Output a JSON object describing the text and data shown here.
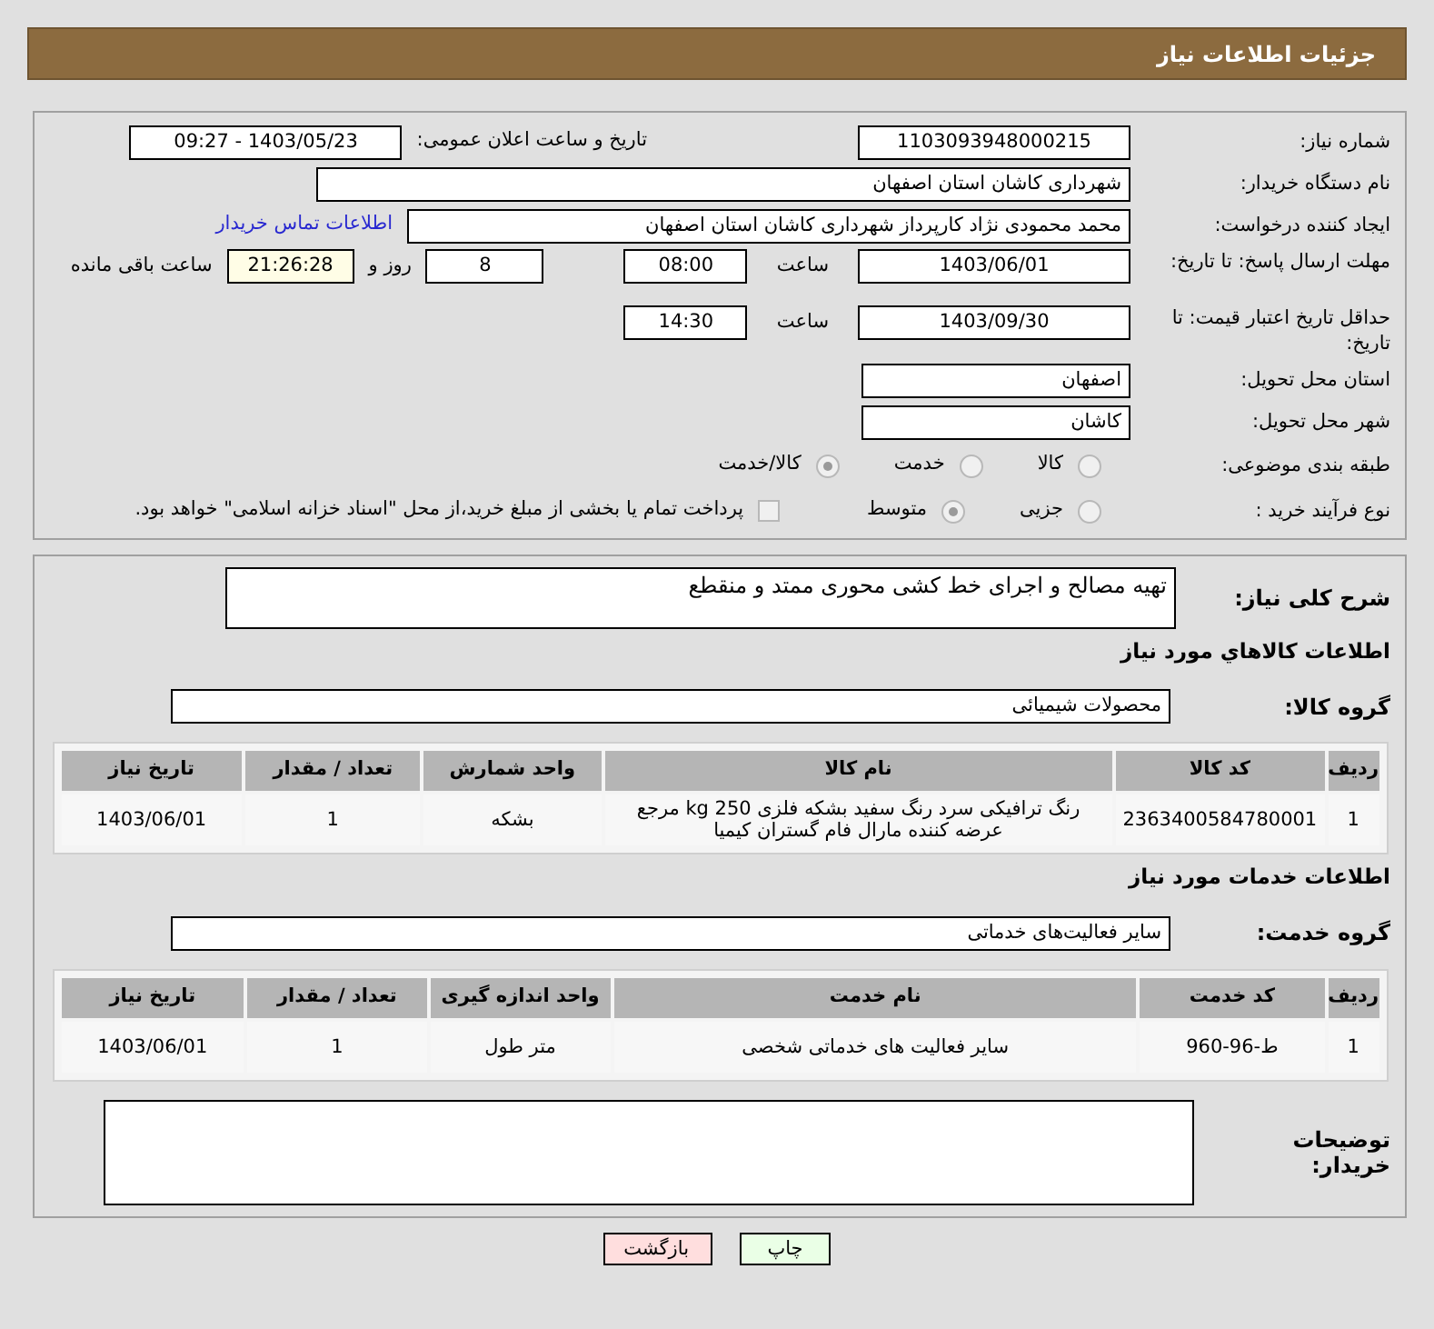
{
  "header": {
    "title": "جزئیات اطلاعات نیاز"
  },
  "need_number": {
    "label": "شماره نیاز:",
    "value": "1103093948000215"
  },
  "announce": {
    "label": "تاریخ و ساعت اعلان عمومی:",
    "value": "1403/05/23 - 09:27"
  },
  "buyer_org": {
    "label": "نام دستگاه خریدار:",
    "value": "شهرداری کاشان استان اصفهان"
  },
  "requester": {
    "label": "ایجاد کننده درخواست:",
    "value": "محمد محمودی نژاد کارپرداز شهرداری کاشان استان اصفهان",
    "link": "اطلاعات تماس خریدار"
  },
  "reply_deadline": {
    "label": "مهلت ارسال پاسخ: تا تاریخ:",
    "date": "1403/06/01",
    "time_label": "ساعت",
    "time": "08:00",
    "days": "8",
    "days_label": "روز و",
    "remaining": "21:26:28",
    "remaining_label": "ساعت باقی مانده"
  },
  "price_validity": {
    "label": "حداقل تاریخ اعتبار قیمت: تا تاریخ:",
    "date": "1403/09/30",
    "time_label": "ساعت",
    "time": "14:30"
  },
  "province": {
    "label": "استان محل تحویل:",
    "value": "اصفهان"
  },
  "city": {
    "label": "شهر محل تحویل:",
    "value": "کاشان"
  },
  "category": {
    "label": "طبقه بندی موضوعی:",
    "options": [
      {
        "label": "کالا",
        "selected": false
      },
      {
        "label": "خدمت",
        "selected": false
      },
      {
        "label": "کالا/خدمت",
        "selected": true
      }
    ]
  },
  "process": {
    "label": "نوع فرآیند خرید :",
    "options": [
      {
        "label": "جزیی",
        "selected": false
      },
      {
        "label": "متوسط",
        "selected": true
      }
    ],
    "payment": {
      "checked": false,
      "text": "پرداخت تمام یا بخشی از مبلغ خرید،از محل \"اسناد خزانه اسلامی\" خواهد بود."
    }
  },
  "description": {
    "label": "شرح کلی نیاز:",
    "value": "تهیه مصالح و اجرای خط کشی محوری ممتد و منقطع"
  },
  "goods": {
    "title": "اطلاعات کالاهاي مورد نياز",
    "group_label": "گروه کالا:",
    "group_value": "محصولات شیمیائی",
    "columns": [
      "ردیف",
      "کد کالا",
      "نام کالا",
      "واحد شمارش",
      "تعداد / مقدار",
      "تاریخ نیاز"
    ],
    "rows": [
      [
        "1",
        "2363400584780001",
        "رنگ ترافیکی سرد رنگ سفید بشکه فلزی 250 kg مرجع عرضه کننده مارال فام گستران کیمیا",
        "بشکه",
        "1",
        "1403/06/01"
      ]
    ]
  },
  "services": {
    "title": "اطلاعات خدمات مورد نیاز",
    "group_label": "گروه خدمت:",
    "group_value": "سایر فعالیت‌های خدماتی",
    "columns": [
      "ردیف",
      "کد خدمت",
      "نام خدمت",
      "واحد اندازه گیری",
      "تعداد / مقدار",
      "تاریخ نیاز"
    ],
    "rows": [
      [
        "1",
        "ط-96-960",
        "سایر فعالیت های خدماتی شخصی",
        "متر طول",
        "1",
        "1403/06/01"
      ]
    ]
  },
  "buyer_notes": {
    "label": "توضیحات خریدار:"
  },
  "buttons": [
    {
      "label": "چاپ",
      "kind": "print"
    },
    {
      "label": "بازگشت",
      "kind": "back"
    }
  ]
}
